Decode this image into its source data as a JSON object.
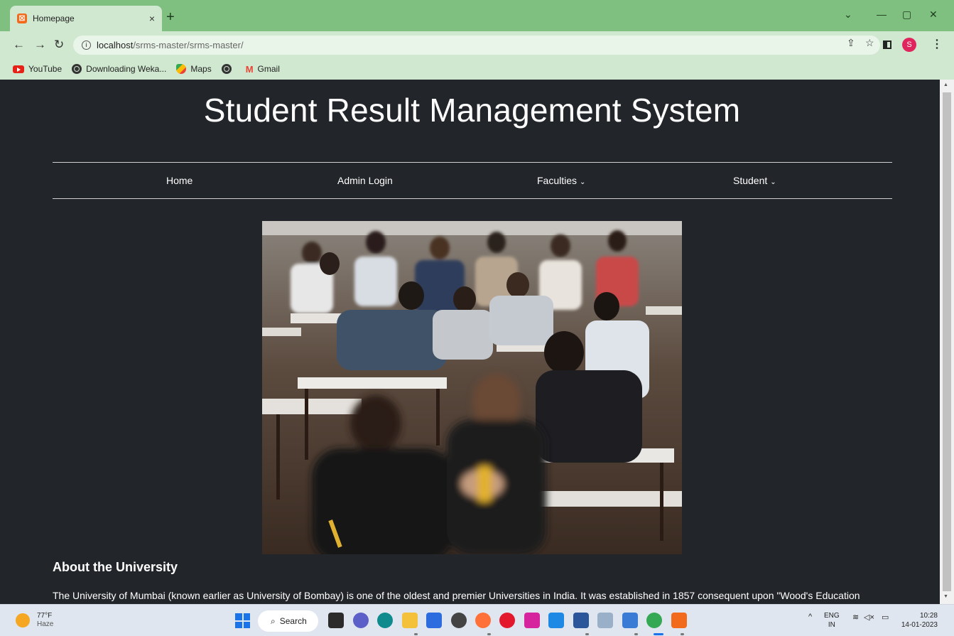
{
  "browser": {
    "tab_title": "Homepage",
    "tab_close": "×",
    "new_tab": "+",
    "url_host": "localhost",
    "url_path": "/srms-master/srms-master/",
    "profile_initial": "S",
    "bookmarks": [
      "YouTube",
      "Downloading Weka...",
      "Maps",
      "",
      "Gmail"
    ]
  },
  "site": {
    "title": "Student Result Management System",
    "nav": [
      "Home",
      "Admin Login",
      "Faculties",
      "Student"
    ],
    "about_title": "About the University",
    "about_text": "The University of Mumbai (known earlier as University of Bombay) is one of the oldest and premier Universities in India. It was established in 1857 consequent upon \"Wood's Education"
  },
  "taskbar": {
    "temperature": "77°F",
    "weather": "Haze",
    "search_label": "Search",
    "lang": "ENG",
    "region": "IN",
    "time": "10:28",
    "date": "14-01-2023"
  },
  "colors": {
    "page_bg": "#222529",
    "chrome_green": "#7fbf7f",
    "toolbar_green": "#cfe8cf"
  }
}
